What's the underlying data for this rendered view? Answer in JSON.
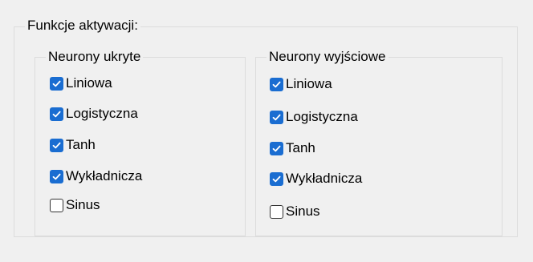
{
  "group_title": "Funkcje aktywacji:",
  "hidden": {
    "title": "Neurony ukryte",
    "items": [
      {
        "label": "Liniowa",
        "checked": true
      },
      {
        "label": "Logistyczna",
        "checked": true
      },
      {
        "label": "Tanh",
        "checked": true
      },
      {
        "label": "Wykładnicza",
        "checked": true
      },
      {
        "label": "Sinus",
        "checked": false
      }
    ]
  },
  "output": {
    "title": "Neurony wyjściowe",
    "items": [
      {
        "label": "Liniowa",
        "checked": true
      },
      {
        "label": "Logistyczna",
        "checked": true
      },
      {
        "label": "Tanh",
        "checked": true
      },
      {
        "label": "Wykładnicza",
        "checked": true
      },
      {
        "label": "Sinus",
        "checked": false
      }
    ]
  },
  "colors": {
    "check_accent": "#1a6dd1",
    "frame": "#dcdcdc",
    "background": "#f0f0f0"
  }
}
